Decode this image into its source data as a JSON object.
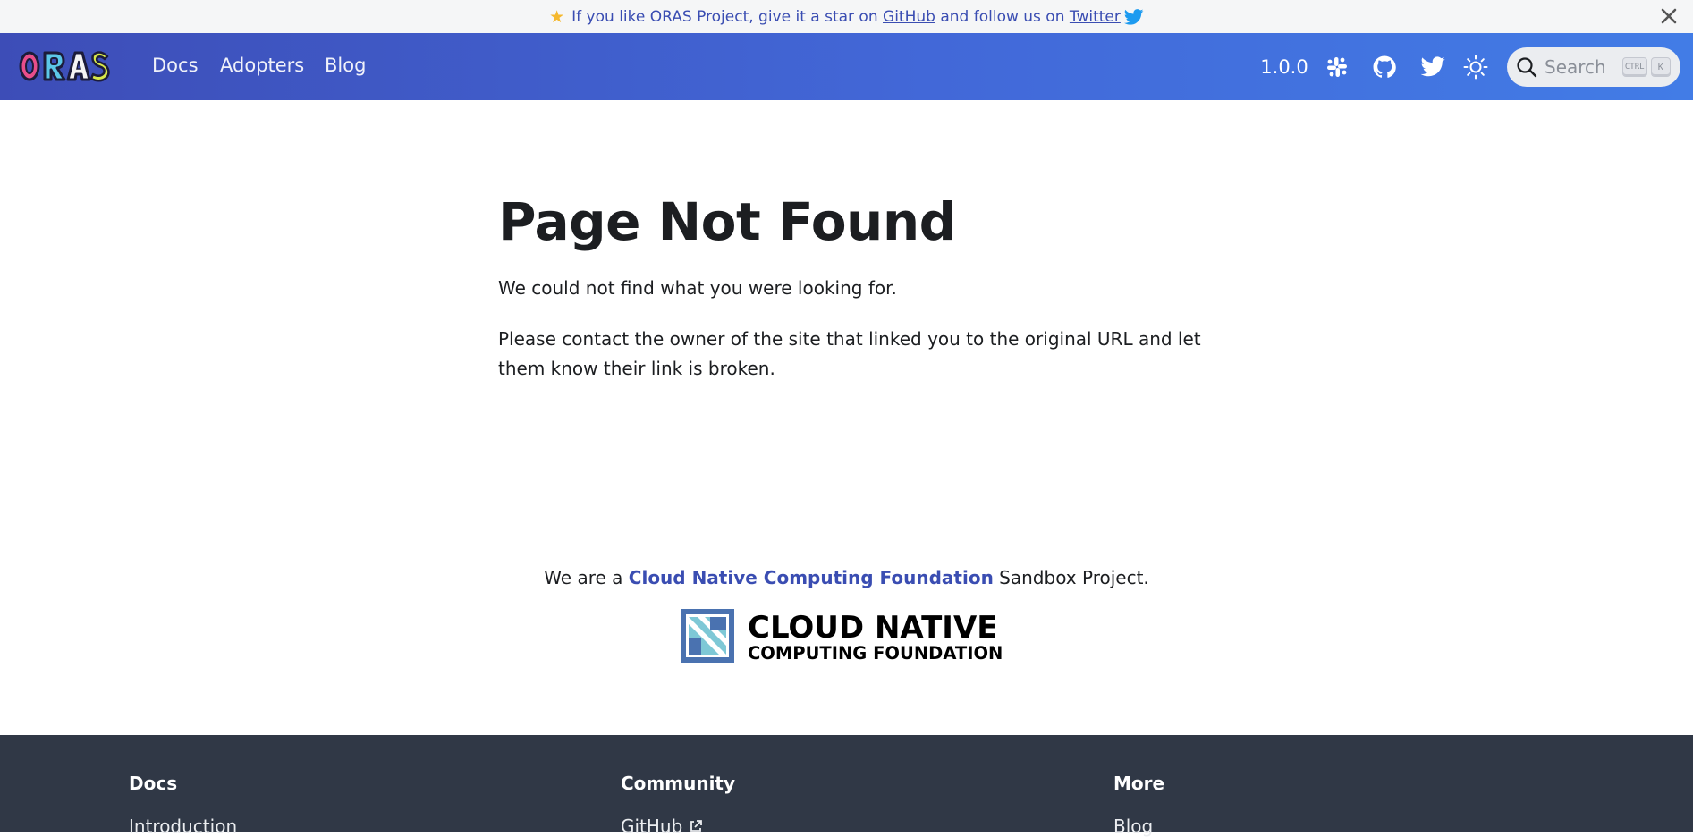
{
  "announcement": {
    "prefix": "If you like ORAS Project, give it a star on",
    "github_link": "GitHub",
    "middle": "and follow us on",
    "twitter_link": "Twitter"
  },
  "navbar": {
    "brand": "ORAS",
    "links": [
      "Docs",
      "Adopters",
      "Blog"
    ],
    "version": "1.0.0",
    "search_placeholder": "Search",
    "search_keys": [
      "CTRL",
      "K"
    ]
  },
  "main": {
    "title": "Page Not Found",
    "paragraph1": "We could not find what you were looking for.",
    "paragraph2": "Please contact the owner of the site that linked you to the original URL and let them know their link is broken."
  },
  "cncf": {
    "prefix": "We are a",
    "link": "Cloud Native Computing Foundation",
    "suffix": "Sandbox Project.",
    "logo_line1": "CLOUD NATIVE",
    "logo_line2": "COMPUTING FOUNDATION"
  },
  "footer": {
    "columns": [
      {
        "title": "Docs",
        "first_link": "Introduction"
      },
      {
        "title": "Community",
        "first_link": "GitHub"
      },
      {
        "title": "More",
        "first_link": "Blog"
      }
    ]
  },
  "colors": {
    "nav_start": "#3d4db7",
    "nav_end": "#427ce6",
    "link": "#3a4db2",
    "footer_bg": "#303846"
  }
}
